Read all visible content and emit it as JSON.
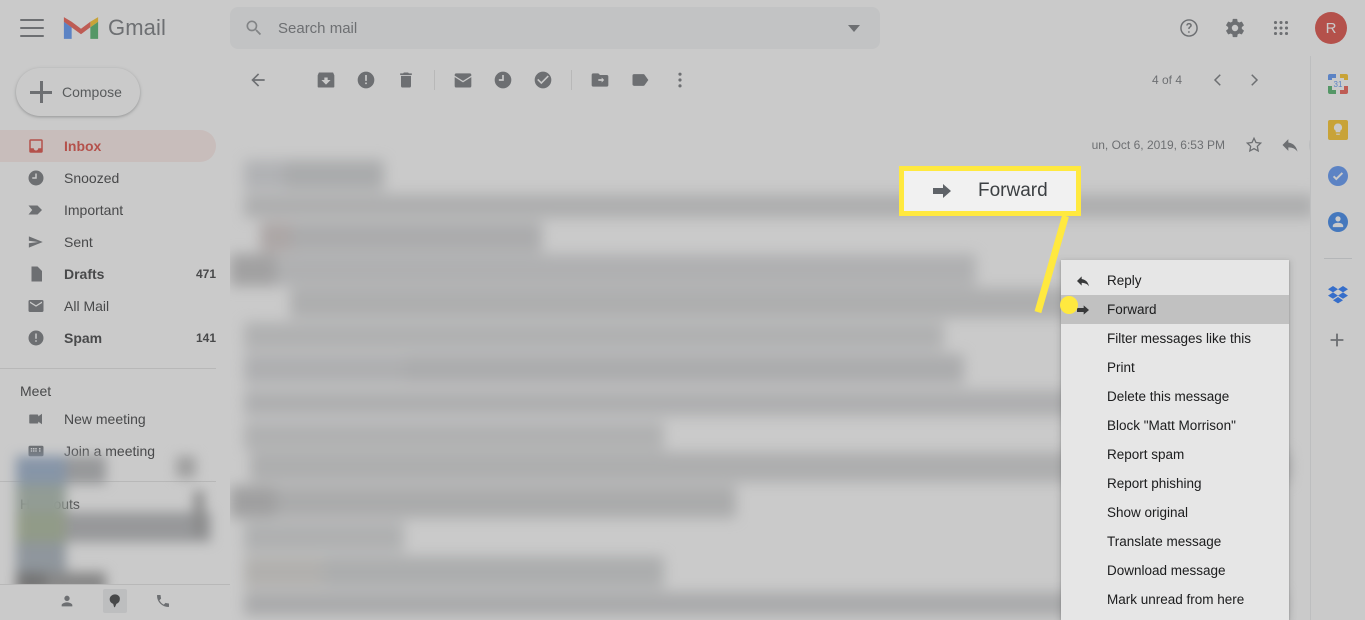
{
  "header": {
    "menu_icon": "hamburger-icon",
    "brand": "Gmail",
    "help_icon": "help-icon",
    "settings_icon": "gear-icon",
    "apps_icon": "apps-grid-icon",
    "avatar_initial": "R"
  },
  "search": {
    "placeholder": "Search mail",
    "value": "",
    "search_icon": "search-icon",
    "options_icon": "chevron-down-icon"
  },
  "sidebar": {
    "compose_label": "Compose",
    "items": [
      {
        "label": "Inbox",
        "count": "",
        "icon": "inbox-icon",
        "active": true,
        "bold": true
      },
      {
        "label": "Snoozed",
        "count": "",
        "icon": "clock-icon",
        "active": false,
        "bold": false
      },
      {
        "label": "Important",
        "count": "",
        "icon": "important-icon",
        "active": false,
        "bold": false
      },
      {
        "label": "Sent",
        "count": "",
        "icon": "send-icon",
        "active": false,
        "bold": false
      },
      {
        "label": "Drafts",
        "count": "471",
        "icon": "draft-icon",
        "active": false,
        "bold": true
      },
      {
        "label": "All Mail",
        "count": "",
        "icon": "mail-icon",
        "active": false,
        "bold": false
      },
      {
        "label": "Spam",
        "count": "141",
        "icon": "spam-icon",
        "active": false,
        "bold": true
      }
    ],
    "meet": {
      "title": "Meet",
      "items": [
        {
          "label": "New meeting",
          "icon": "video-camera-icon"
        },
        {
          "label": "Join a meeting",
          "icon": "keyboard-icon"
        }
      ]
    },
    "hangouts": {
      "title": "Hangouts",
      "footer_icons": [
        "contacts-person-icon",
        "hangouts-balloon-icon",
        "phone-icon"
      ]
    }
  },
  "toolbar": {
    "buttons": [
      {
        "name": "back-icon",
        "label": "Back to Inbox"
      },
      {
        "name": "archive-icon",
        "label": "Archive"
      },
      {
        "name": "report-spam-icon",
        "label": "Report spam"
      },
      {
        "name": "delete-icon",
        "label": "Delete"
      },
      {
        "name": "mark-unread-icon",
        "label": "Mark as unread"
      },
      {
        "name": "snooze-icon",
        "label": "Snooze"
      },
      {
        "name": "add-to-tasks-icon",
        "label": "Add to Tasks"
      },
      {
        "name": "move-to-icon",
        "label": "Move to"
      },
      {
        "name": "labels-icon",
        "label": "Labels"
      },
      {
        "name": "more-icon",
        "label": "More"
      }
    ],
    "pager": {
      "count_text": "4 of 4",
      "prev_icon": "chevron-left-icon",
      "next_icon": "chevron-right-icon"
    }
  },
  "message": {
    "date": "un, Oct 6, 2019, 6:53 PM",
    "star_icon": "star-icon",
    "reply_icon": "reply-arrow-icon",
    "more_icon": "more-vertical-icon"
  },
  "context_menu": {
    "items": [
      {
        "label": "Reply",
        "icon": "reply-arrow-icon",
        "highlighted": false
      },
      {
        "label": "Forward",
        "icon": "forward-arrow-icon",
        "highlighted": true
      },
      {
        "label": "Filter messages like this",
        "icon": "",
        "highlighted": false
      },
      {
        "label": "Print",
        "icon": "",
        "highlighted": false
      },
      {
        "label": "Delete this message",
        "icon": "",
        "highlighted": false
      },
      {
        "label": "Block \"Matt Morrison\"",
        "icon": "",
        "highlighted": false
      },
      {
        "label": "Report spam",
        "icon": "",
        "highlighted": false
      },
      {
        "label": "Report phishing",
        "icon": "",
        "highlighted": false
      },
      {
        "label": "Show original",
        "icon": "",
        "highlighted": false
      },
      {
        "label": "Translate message",
        "icon": "",
        "highlighted": false
      },
      {
        "label": "Download message",
        "icon": "",
        "highlighted": false
      },
      {
        "label": "Mark unread from here",
        "icon": "",
        "highlighted": false
      }
    ]
  },
  "callout": {
    "label": "Forward",
    "icon": "forward-arrow-icon",
    "highlight_color": "#ffe93f",
    "background_color": "#f1f1f1"
  },
  "rail": {
    "items": [
      {
        "name": "google-calendar-icon",
        "label": "Calendar"
      },
      {
        "name": "google-keep-icon",
        "label": "Keep"
      },
      {
        "name": "google-tasks-icon",
        "label": "Tasks"
      },
      {
        "name": "google-contacts-icon",
        "label": "Contacts"
      },
      {
        "name": "dropbox-icon",
        "label": "Dropbox"
      },
      {
        "name": "add-addon-icon",
        "label": "Get add-ons"
      }
    ]
  },
  "colors": {
    "accent_red": "#d93025",
    "inbox_pill": "#fce8e6",
    "highlight_yellow": "#ffe93f",
    "text_primary": "#202124",
    "text_secondary": "#5f6368"
  }
}
